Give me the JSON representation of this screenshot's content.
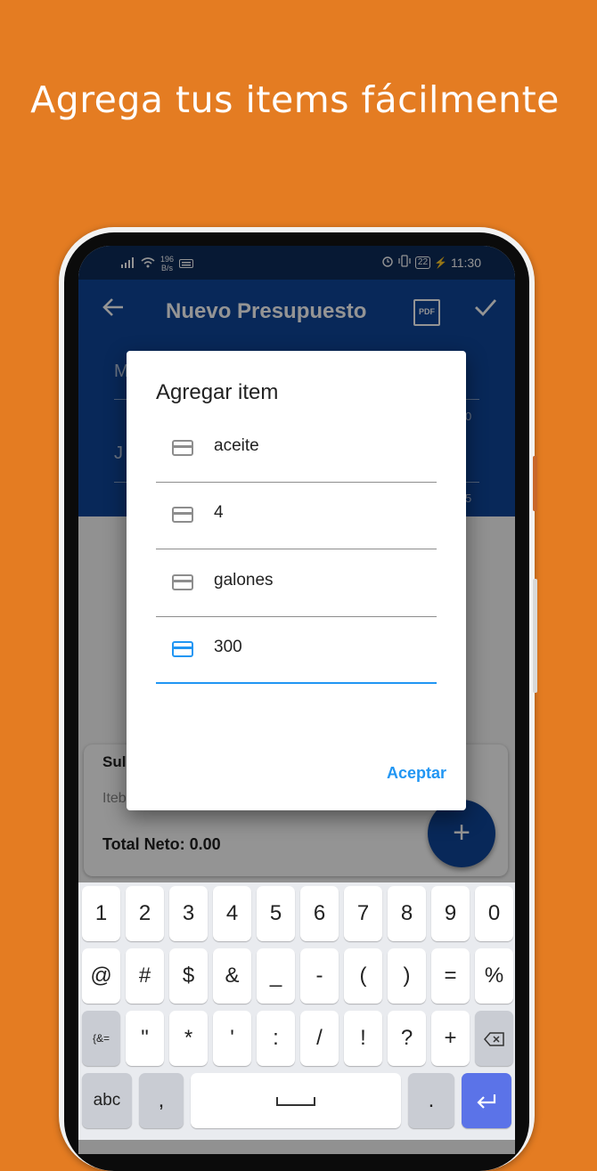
{
  "headline": "Agrega tus items fácilmente",
  "status": {
    "speed_value": "196",
    "speed_unit": "B/s",
    "battery": "22",
    "time": "11:30"
  },
  "appbar": {
    "title": "Nuevo Presupuesto",
    "pdf_label": "PDF"
  },
  "form": {
    "field1_initial": "M",
    "field2_initial": "J",
    "field1_counter": "0",
    "field2_counter": "5"
  },
  "summary": {
    "title": "Sul",
    "items_label": "Iteb",
    "total": "Total Neto: 0.00"
  },
  "dialog": {
    "title": "Agregar item",
    "fields": [
      {
        "value": "aceite"
      },
      {
        "value": "4"
      },
      {
        "value": "galones"
      },
      {
        "value": "300"
      }
    ],
    "accept_label": "Aceptar"
  },
  "keyboard": {
    "row1": [
      "1",
      "2",
      "3",
      "4",
      "5",
      "6",
      "7",
      "8",
      "9",
      "0"
    ],
    "row2": [
      "@",
      "#",
      "$",
      "&",
      "_",
      "-",
      "(",
      ")",
      "=",
      "%"
    ],
    "row3": [
      "{&=",
      "\"",
      "*",
      "'",
      ":",
      "/",
      "!",
      "?",
      "+"
    ],
    "row4": [
      "abc",
      ",",
      ".",
      ""
    ]
  },
  "colors": {
    "background": "#E47C22",
    "app_primary": "#0E459A",
    "accent": "#2196F3"
  }
}
